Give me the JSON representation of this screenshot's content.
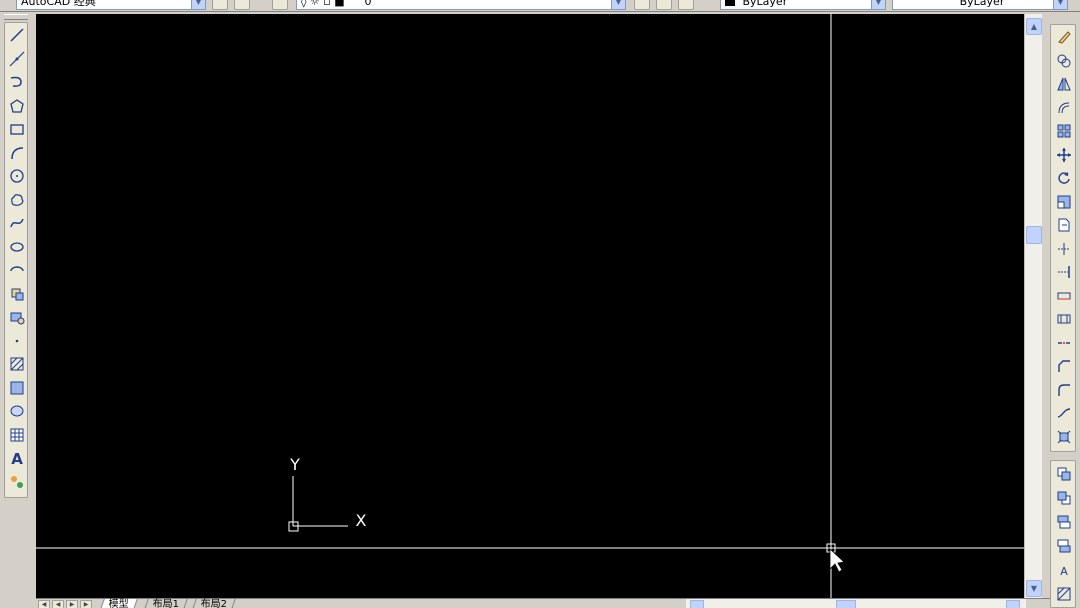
{
  "top_toolbar": {
    "workspace_combo": "AutoCAD 经典",
    "layer_combo": "0",
    "color_combo": "ByLayer",
    "linetype_combo": "ByLayer"
  },
  "ucs_icon": {
    "x_label": "X",
    "y_label": "Y"
  },
  "layout_tabs": [
    {
      "label": "模型",
      "active": true
    },
    {
      "label": "布局1",
      "active": false
    },
    {
      "label": "布局2",
      "active": false
    }
  ],
  "left_toolbar_icons": [
    "line-icon",
    "construction-line-icon",
    "polyline-icon",
    "polygon-icon",
    "rectangle-icon",
    "arc-icon",
    "circle-icon",
    "revision-cloud-icon",
    "spline-icon",
    "ellipse-icon",
    "ellipse-arc-icon",
    "insert-block-icon",
    "make-block-icon",
    "point-icon",
    "hatch-icon",
    "gradient-icon",
    "region-icon",
    "table-icon",
    "multiline-text-icon",
    "add-selected-icon"
  ],
  "right_toolbar_icons": [
    "erase-icon",
    "copy-icon",
    "mirror-icon",
    "offset-icon",
    "array-icon",
    "move-icon",
    "rotate-icon",
    "scale-icon",
    "stretch-icon",
    "trim-icon",
    "extend-icon",
    "break-at-point-icon",
    "break-icon",
    "join-icon",
    "chamfer-icon",
    "fillet-icon",
    "blend-icon",
    "explode-icon"
  ],
  "right_toolbar2_icons": [
    "draworder-front-icon",
    "draworder-back-icon",
    "draworder-above-icon",
    "draworder-under-icon",
    "text-front-icon",
    "hatch-back-icon"
  ],
  "colors": {
    "canvas": "#000000",
    "crosshair": "#ffffff",
    "chrome": "#d4d0c8"
  }
}
